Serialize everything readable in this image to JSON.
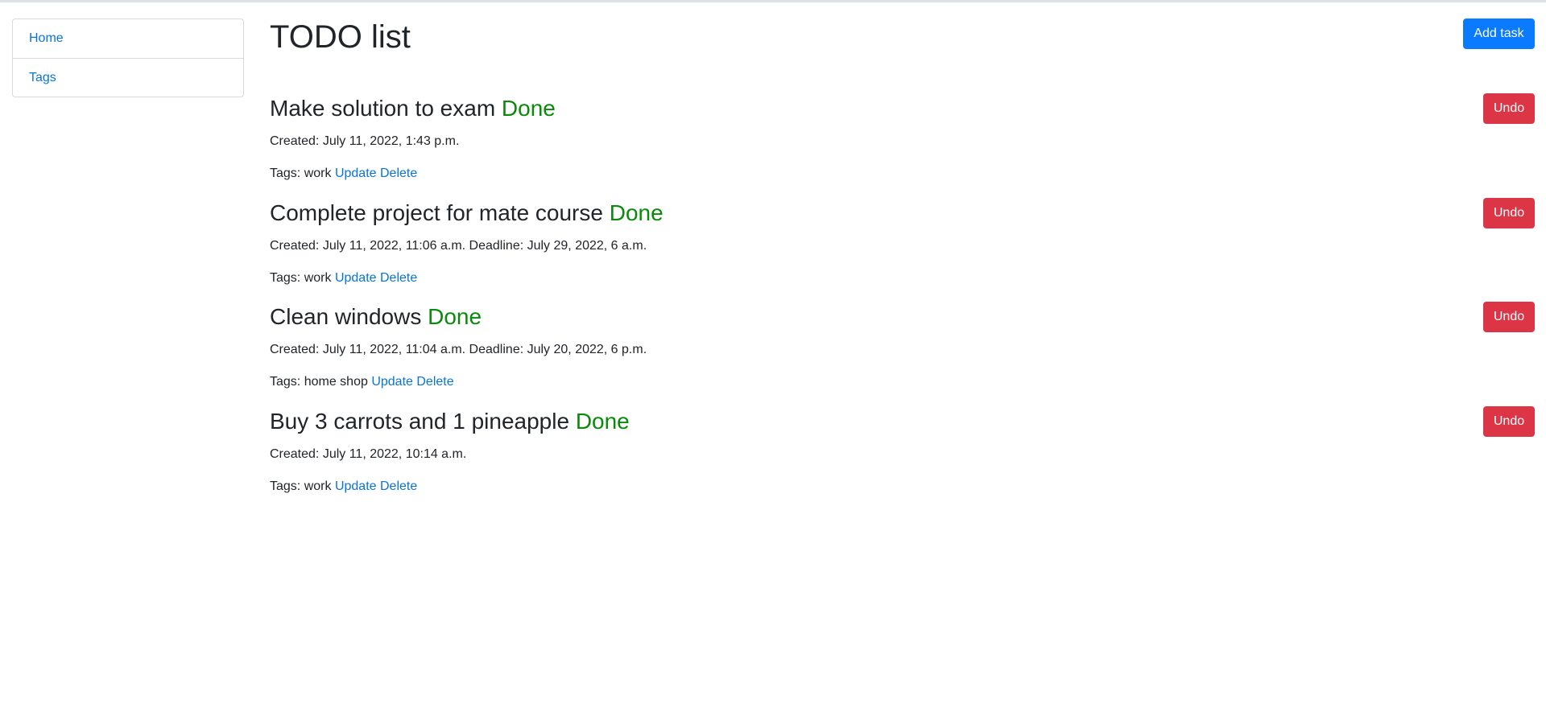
{
  "sidebar": {
    "items": [
      {
        "label": "Home"
      },
      {
        "label": "Tags"
      }
    ]
  },
  "header": {
    "title": "TODO list",
    "add_task_label": "Add task"
  },
  "tasks": [
    {
      "title": "Make solution to exam",
      "status": "Done",
      "meta": "Created: July 11, 2022, 1:43 p.m.",
      "tags_label": "Tags:",
      "tags": "work",
      "update_label": "Update",
      "delete_label": "Delete",
      "undo_label": "Undo"
    },
    {
      "title": "Complete project for mate course",
      "status": "Done",
      "meta": "Created: July 11, 2022, 11:06 a.m. Deadline: July 29, 2022, 6 a.m.",
      "tags_label": "Tags:",
      "tags": "work",
      "update_label": "Update",
      "delete_label": "Delete",
      "undo_label": "Undo"
    },
    {
      "title": "Clean windows",
      "status": "Done",
      "meta": "Created: July 11, 2022, 11:04 a.m. Deadline: July 20, 2022, 6 p.m.",
      "tags_label": "Tags:",
      "tags": "home shop",
      "update_label": "Update",
      "delete_label": "Delete",
      "undo_label": "Undo"
    },
    {
      "title": "Buy 3 carrots and 1 pineapple",
      "status": "Done",
      "meta": "Created: July 11, 2022, 10:14 a.m.",
      "tags_label": "Tags:",
      "tags": "work",
      "update_label": "Update",
      "delete_label": "Delete",
      "undo_label": "Undo"
    }
  ],
  "colors": {
    "link": "#0a74d6",
    "primary": "#0a7bff",
    "danger": "#dc3545",
    "done": "#0a8a0a"
  }
}
